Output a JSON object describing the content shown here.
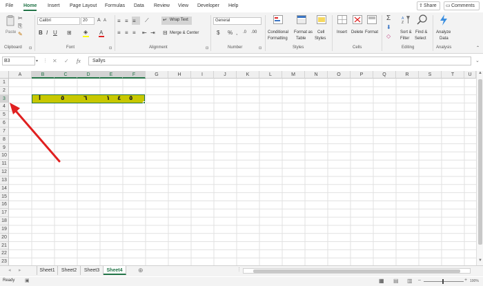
{
  "menu": {
    "tabs": [
      "File",
      "Home",
      "Insert",
      "Page Layout",
      "Formulas",
      "Data",
      "Review",
      "View",
      "Developer",
      "Help"
    ],
    "active": "Home",
    "share_label": "Share",
    "comments_label": "Comments"
  },
  "ribbon": {
    "clipboard": {
      "paste_label": "Paste",
      "group_label": "Clipboard"
    },
    "font": {
      "font_name": "Calibri",
      "font_size": "20",
      "group_label": "Font"
    },
    "alignment": {
      "wrap_text_label": "Wrap Text",
      "merge_label": "Merge & Center",
      "group_label": "Alignment"
    },
    "number": {
      "format": "General",
      "group_label": "Number"
    },
    "styles": {
      "conditional_1": "Conditional",
      "conditional_2": "Formatting",
      "format_table_1": "Format as",
      "format_table_2": "Table",
      "cell_styles_1": "Cell",
      "cell_styles_2": "Styles",
      "group_label": "Styles"
    },
    "cells": {
      "insert_label": "Insert",
      "delete_label": "Delete",
      "format_label": "Format",
      "group_label": "Cells"
    },
    "editing": {
      "sort_1": "Sort &",
      "sort_2": "Filter",
      "find_1": "Find &",
      "find_2": "Select",
      "group_label": "Editing"
    },
    "analysis": {
      "analyze_1": "Analyze",
      "analyze_2": "Data",
      "group_label": "Analysis"
    },
    "icon_names": [
      "paste-icon",
      "cut-icon",
      "copy-icon",
      "format-painter-icon",
      "bold-icon",
      "italic-icon",
      "underline-icon",
      "borders-icon",
      "fill-color-icon",
      "font-color-icon",
      "align-icon",
      "currency-icon",
      "percent-icon",
      "comma-icon",
      "sum-icon",
      "fill-icon",
      "clear-icon",
      "analyze-data-icon"
    ]
  },
  "formula_bar": {
    "name_box": "B3",
    "fx_label": "fx",
    "cancel_symbol": "✕",
    "enter_symbol": "✓",
    "value": "Sallys"
  },
  "grid": {
    "columns": [
      "A",
      "B",
      "C",
      "D",
      "E",
      "F",
      "G",
      "H",
      "I",
      "J",
      "K",
      "L",
      "M",
      "N",
      "O",
      "P",
      "Q",
      "R",
      "S",
      "T",
      "U"
    ],
    "rows": [
      "1",
      "2",
      "3",
      "4",
      "5",
      "6",
      "7",
      "8",
      "9",
      "10",
      "11",
      "12",
      "13",
      "14",
      "15",
      "16",
      "17",
      "18",
      "19",
      "20",
      "21",
      "22",
      "23"
    ],
    "selected_cell": "B3",
    "highlight_color": "#c8c800",
    "cells_row3": [
      "ا",
      "٥",
      "٦",
      "١",
      "٤",
      "٥"
    ]
  },
  "sheets": {
    "tabs": [
      "Sheet1",
      "Sheet2",
      "Sheet3",
      "Sheet4"
    ],
    "active": "Sheet4",
    "add_symbol": "⊕"
  },
  "status": {
    "mode": "Ready",
    "zoom": "100%"
  },
  "colors": {
    "accent": "#217346",
    "annotation_arrow": "#e02020"
  }
}
